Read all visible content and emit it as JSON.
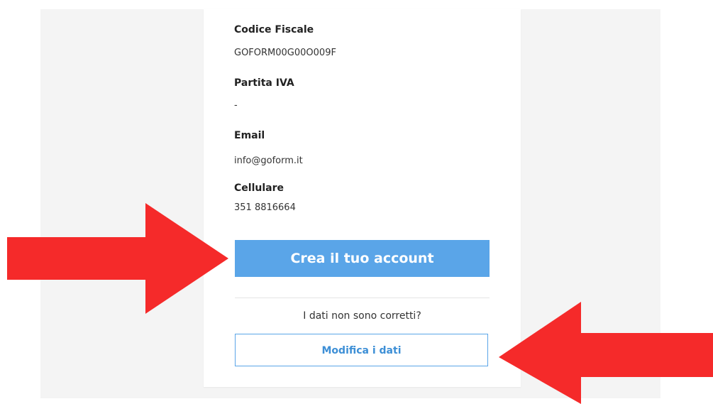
{
  "details": {
    "fiscal_code": {
      "label": "Codice Fiscale",
      "value": "GOFORM00G00O009F"
    },
    "vat": {
      "label": "Partita IVA",
      "value": "-"
    },
    "email": {
      "label": "Email",
      "value": "info@goform.it"
    },
    "mobile": {
      "label": "Cellulare",
      "value": "351 8816664"
    }
  },
  "actions": {
    "create_account_label": "Crea il tuo account",
    "question_text": "I dati non sono corretti?",
    "edit_data_label": "Modifica i dati"
  },
  "colors": {
    "accent": "#5aa5e8",
    "arrow": "#f52a2a",
    "panel_background": "#f4f4f4"
  }
}
